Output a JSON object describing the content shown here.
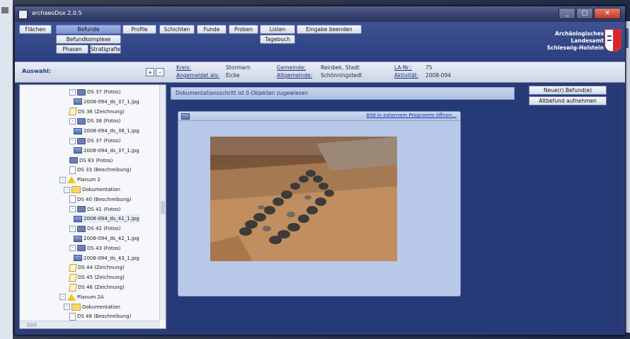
{
  "window": {
    "title": "archaeoDox 2.0.5"
  },
  "menu": {
    "row1": [
      "Flächen",
      "Befunde",
      "Profile",
      "Schichten",
      "Funde",
      "Proben",
      "Listen",
      "Eingabe beenden"
    ],
    "row2": [
      "Befundkomplexe",
      "Tagebuch"
    ],
    "row3": [
      "Phasen",
      "Stratigrafie"
    ],
    "active": "Befunde"
  },
  "org": {
    "line1": "Archäologisches",
    "line2": "Landesamt",
    "line3": "Schleswig-Holstein"
  },
  "infobar": {
    "auswahl": "Auswahl:",
    "plus": "+",
    "minus": "-",
    "kreis_label": "Kreis:",
    "kreis_value": "Stormarn",
    "angemeldet_label": "Angemeldet als:",
    "angemeldet_value": "Eicke",
    "gemeinde_label": "Gemeinde:",
    "gemeinde_value": "Reinbek, Stadt",
    "altgemeinde_label": "Altgemeinde:",
    "altgemeinde_value": "Schönningstedt",
    "la_label": "LA-Nr.:",
    "la_value": "75",
    "aktivitaet_label": "Aktivität:",
    "aktivitaet_value": "2008-094"
  },
  "tree": {
    "items": [
      {
        "label": "DS 37 (Fotos)",
        "icon": "photo-icon",
        "exp": "-"
      },
      {
        "label": "2008-094_ds_37_1.jpg",
        "icon": "image-icon"
      },
      {
        "label": "DS 36 (Zeichnung)",
        "icon": "drawing-icon"
      },
      {
        "label": "DS 38 (Fotos)",
        "icon": "photo-icon",
        "exp": "-"
      },
      {
        "label": "2008-094_ds_38_1.jpg",
        "icon": "image-icon"
      },
      {
        "label": "DS 37 (Fotos)",
        "icon": "photo-icon",
        "exp": "-"
      },
      {
        "label": "2008-094_ds_37_1.jpg",
        "icon": "image-icon"
      },
      {
        "label": "DS 83 (Fotos)",
        "icon": "photo-icon"
      },
      {
        "label": "DS 33 (Beschreibung)",
        "icon": "description-icon"
      },
      {
        "label": "Planum 2",
        "icon": "warning-icon",
        "exp": "-"
      },
      {
        "label": "Dokumentation",
        "icon": "folder-icon",
        "exp": "-"
      },
      {
        "label": "DS 40 (Beschreibung)",
        "icon": "description-icon"
      },
      {
        "label": "DS 41 (Fotos)",
        "icon": "photo-icon",
        "exp": "-"
      },
      {
        "label": "2008-094_ds_41_1.jpg",
        "icon": "image-icon"
      },
      {
        "label": "DS 42 (Fotos)",
        "icon": "photo-icon",
        "exp": "-"
      },
      {
        "label": "2008-094_ds_42_1.jpg",
        "icon": "image-icon"
      },
      {
        "label": "DS 43 (Fotos)",
        "icon": "photo-icon",
        "exp": "-"
      },
      {
        "label": "2008-094_ds_43_1.jpg",
        "icon": "image-icon"
      },
      {
        "label": "DS 44 (Zeichnung)",
        "icon": "drawing-icon"
      },
      {
        "label": "DS 45 (Zeichnung)",
        "icon": "drawing-icon"
      },
      {
        "label": "DS 46 (Zeichnung)",
        "icon": "drawing-icon"
      },
      {
        "label": "Planum 2A",
        "icon": "warning-icon",
        "exp": "-"
      },
      {
        "label": "Dokumentation",
        "icon": "folder-icon",
        "exp": "-"
      },
      {
        "label": "DS 48 (Beschreibung)",
        "icon": "description-icon"
      }
    ]
  },
  "content": {
    "message": "Dokumentationsschritt ist 0 Objekten zugewiesen",
    "new_button": "Neue(r) Befund(e)",
    "old_button": "Altbefund aufnehmen",
    "external_link": "Bild in externem Programm öffnen..."
  },
  "colors": {
    "accent": "#2c3d74",
    "header": "#3e5294",
    "link": "#1b36b8"
  }
}
